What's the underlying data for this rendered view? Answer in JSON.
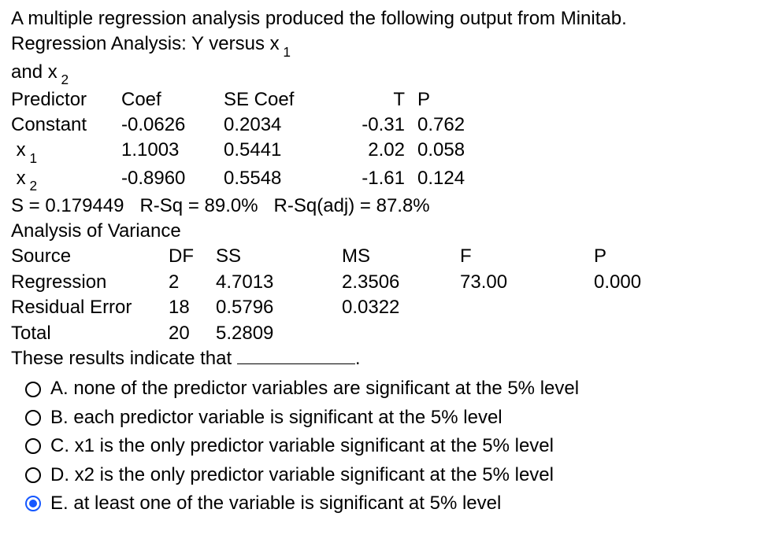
{
  "intro": "A multiple regression analysis produced the following output from Minitab.",
  "line2_a": "Regression Analysis: Y versus x",
  "line2_sub": "1",
  "line3_a": "and x",
  "line3_sub": "2",
  "pred_head": {
    "c0": "Predictor",
    "c1": "Coef",
    "c2": "SE Coef",
    "c3": "T",
    "c4": "P"
  },
  "pred_rows": {
    "r0": {
      "c0": "Constant",
      "c1": "-0.0626",
      "c2": "0.2034",
      "c3": "-0.31",
      "c4": "0.762"
    },
    "r1": {
      "c0a": "x",
      "c0s": "1",
      "c1": "1.1003",
      "c2": "0.5441",
      "c3": "2.02",
      "c4": "0.058"
    },
    "r2": {
      "c0a": "x",
      "c0s": "2",
      "c1": "-0.8960",
      "c2": "0.5548",
      "c3": "-1.61",
      "c4": "0.124"
    }
  },
  "stats": "S = 0.179449   R-Sq = 89.0%   R-Sq(adj) = 87.8%",
  "anv_title": "Analysis of Variance",
  "anv_head": {
    "c0": "Source",
    "c1": "DF",
    "c2": "SS",
    "c3": "MS",
    "c4": "F",
    "c5": "P"
  },
  "anv_rows": {
    "r0": {
      "c0": "Regression",
      "c1": "2",
      "c2": "4.7013",
      "c3": "2.3506",
      "c4": "73.00",
      "c5": "0.000"
    },
    "r1": {
      "c0": "Residual Error",
      "c1": "18",
      "c2": "0.5796",
      "c3": "0.0322",
      "c4": "",
      "c5": ""
    },
    "r2": {
      "c0": "Total",
      "c1": "20",
      "c2": "5.2809",
      "c3": "",
      "c4": "",
      "c5": ""
    }
  },
  "stem": "These results indicate that",
  "stem_end": ".",
  "options": {
    "a": "A. none of the predictor variables are significant at the 5% level",
    "b": "B. each predictor variable is significant at the 5% level",
    "c": "C. x1 is the only predictor variable significant at the 5% level",
    "d": "D. x2 is the only predictor variable significant at the 5% level",
    "e": "E. at least one of the variable is significant at 5% level"
  }
}
